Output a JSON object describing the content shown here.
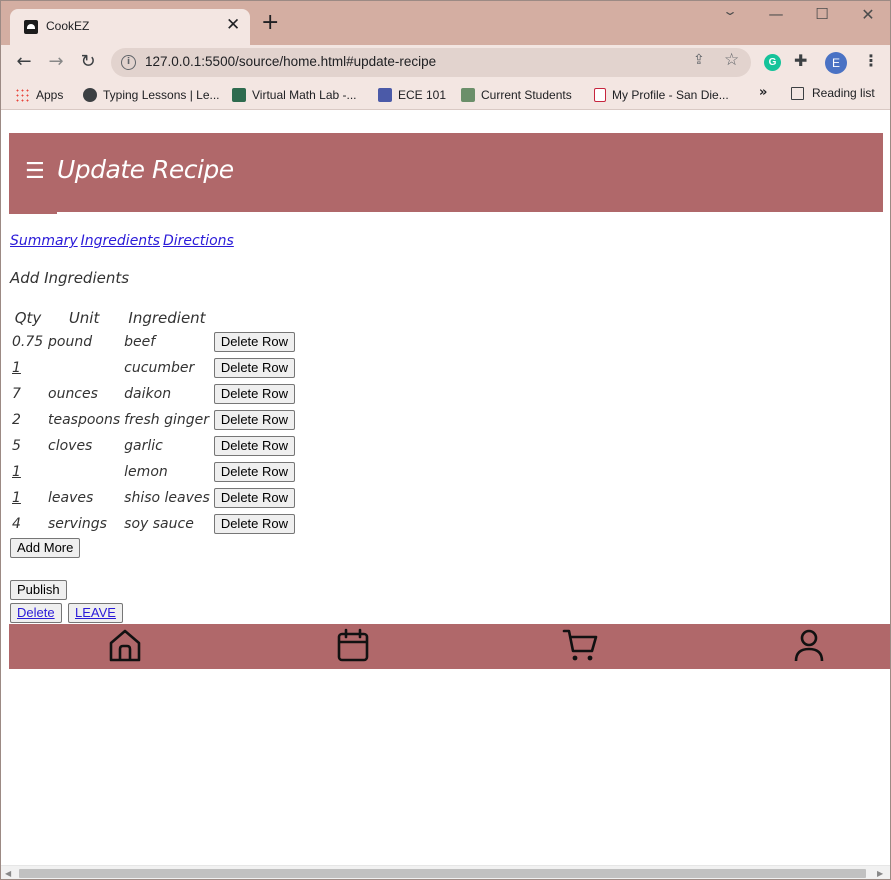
{
  "browser": {
    "tab_title": "CookEZ",
    "tab_close": "✕",
    "new_tab": "+",
    "url": "127.0.0.1:5500/source/home.html#update-recipe",
    "profile_initial": "E",
    "grammarly_letter": "G",
    "window_controls": {
      "chevron": "⌄",
      "minimize": "—",
      "maximize": "☐",
      "close": "✕"
    },
    "nav": {
      "back": "←",
      "forward": "→",
      "reload": "↻"
    },
    "bookmarks": [
      {
        "label": "Apps",
        "icon": "apps-grid-icon"
      },
      {
        "label": "Typing Lessons | Le...",
        "icon": "globe-icon"
      },
      {
        "label": "Virtual Math Lab -...",
        "icon": "sharepoint-icon"
      },
      {
        "label": "ECE 101",
        "icon": "piazza-icon"
      },
      {
        "label": "Current Students",
        "icon": "students-icon"
      },
      {
        "label": "My Profile - San Die...",
        "icon": "sdsu-icon"
      }
    ],
    "bookmarks_overflow": "»",
    "reading_list": "Reading list"
  },
  "header": {
    "menu_glyph": "☰",
    "title": "Update Recipe",
    "color": "#b0686a"
  },
  "section_links": [
    "Summary",
    "Ingredients",
    "Directions"
  ],
  "add_ingredients_label": "Add Ingredients",
  "table": {
    "columns": [
      "Qty",
      "Unit",
      "Ingredient"
    ],
    "rows": [
      {
        "qty": "0.75",
        "unit": "pound",
        "ingredient": "beef"
      },
      {
        "qty": "1",
        "unit": "",
        "ingredient": "cucumber"
      },
      {
        "qty": "7",
        "unit": "ounces",
        "ingredient": "daikon"
      },
      {
        "qty": "2",
        "unit": "teaspoons",
        "ingredient": "fresh ginger"
      },
      {
        "qty": "5",
        "unit": "cloves",
        "ingredient": "garlic"
      },
      {
        "qty": "1",
        "unit": "",
        "ingredient": "lemon"
      },
      {
        "qty": "1",
        "unit": "leaves",
        "ingredient": "shiso leaves"
      },
      {
        "qty": "4",
        "unit": "servings",
        "ingredient": "soy sauce"
      }
    ],
    "delete_row_label": "Delete Row"
  },
  "buttons": {
    "add_more": "Add More",
    "publish": "Publish",
    "delete": "Delete",
    "leave": "LEAVE"
  },
  "bottom_nav": [
    {
      "name": "home",
      "icon": "home-icon"
    },
    {
      "name": "calendar",
      "icon": "calendar-icon"
    },
    {
      "name": "cart",
      "icon": "cart-icon"
    },
    {
      "name": "profile",
      "icon": "user-icon"
    }
  ]
}
